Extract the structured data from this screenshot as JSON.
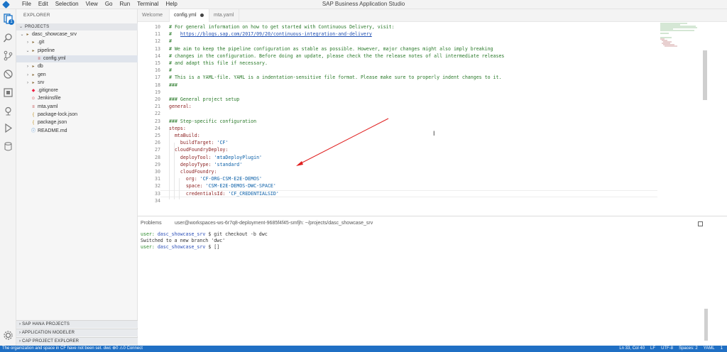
{
  "app": {
    "title": "SAP Business Application Studio",
    "menu": [
      "File",
      "Edit",
      "Selection",
      "View",
      "Go",
      "Run",
      "Terminal",
      "Help"
    ]
  },
  "activity": {
    "badge": "1"
  },
  "sidebar": {
    "title": "EXPLORER",
    "section": "PROJECTS",
    "tree": [
      {
        "label": "dasc_showcase_srv",
        "kind": "folder",
        "twisty": "v",
        "depth": 0
      },
      {
        "label": ".git",
        "kind": "folder",
        "twisty": ">",
        "depth": 1
      },
      {
        "label": "pipeline",
        "kind": "folder",
        "twisty": "v",
        "depth": 1
      },
      {
        "label": "config.yml",
        "kind": "yml",
        "twisty": "",
        "depth": 2,
        "selected": true
      },
      {
        "label": "db",
        "kind": "folder",
        "twisty": ">",
        "depth": 1
      },
      {
        "label": "gen",
        "kind": "folder",
        "twisty": ">",
        "depth": 1
      },
      {
        "label": "srv",
        "kind": "folder",
        "twisty": ">",
        "depth": 1
      },
      {
        "label": ".gitignore",
        "kind": "git",
        "twisty": "",
        "depth": 1
      },
      {
        "label": "Jenkinsfile",
        "kind": "jenkins",
        "twisty": "",
        "depth": 1
      },
      {
        "label": "mta.yaml",
        "kind": "yml",
        "twisty": "",
        "depth": 1
      },
      {
        "label": "package-lock.json",
        "kind": "json",
        "twisty": "",
        "depth": 1
      },
      {
        "label": "package.json",
        "kind": "json",
        "twisty": "",
        "depth": 1
      },
      {
        "label": "README.md",
        "kind": "md",
        "twisty": "",
        "depth": 1
      }
    ],
    "bottom_sections": [
      "SAP HANA PROJECTS",
      "APPLICATION MODELER",
      "CAP PROJECT EXPLORER"
    ]
  },
  "tabs": [
    {
      "label": "Welcome",
      "active": false
    },
    {
      "label": "config.yml",
      "active": true,
      "dirty": true
    },
    {
      "label": "mta.yaml",
      "active": false
    }
  ],
  "editor": {
    "lines": [
      {
        "n": "10",
        "text": "# For general information on how to get started with Continuous Delivery, visit:",
        "cls": "c-comment"
      },
      {
        "n": "11",
        "text": "#   ",
        "cls": "c-comment",
        "url": "https://blogs.sap.com/2017/09/20/continuous-integration-and-delivery"
      },
      {
        "n": "12",
        "text": "#",
        "cls": "c-comment"
      },
      {
        "n": "13",
        "text": "# We aim to keep the pipeline configuration as stable as possible. However, major changes might also imply breaking",
        "cls": "c-comment"
      },
      {
        "n": "14",
        "text": "# changes in the configuration. Before doing an update, please check the the release notes of all intermediate releases",
        "cls": "c-comment"
      },
      {
        "n": "15",
        "text": "# and adapt this file if necessary.",
        "cls": "c-comment"
      },
      {
        "n": "16",
        "text": "#",
        "cls": "c-comment"
      },
      {
        "n": "17",
        "text": "# This is a YAML-file. YAML is a indentation-sensitive file format. Please make sure to properly indent changes to it.",
        "cls": "c-comment"
      },
      {
        "n": "18",
        "text": "###",
        "cls": "c-comment"
      },
      {
        "n": "19",
        "text": "",
        "cls": ""
      },
      {
        "n": "20",
        "text": "### General project setup",
        "cls": "c-comment"
      },
      {
        "n": "21",
        "text": "general:",
        "cls": "c-key"
      },
      {
        "n": "22",
        "text": "",
        "cls": ""
      },
      {
        "n": "23",
        "text": "### Step-specific configuration",
        "cls": "c-comment"
      },
      {
        "n": "24",
        "text": "steps:",
        "cls": "c-key"
      },
      {
        "n": "25",
        "text": "  mtaBuild:",
        "cls": "c-key"
      },
      {
        "n": "26",
        "key": "    buildTarget: ",
        "val": "'CF'"
      },
      {
        "n": "27",
        "text": "  cloudFoundryDeploy:",
        "cls": "c-key"
      },
      {
        "n": "28",
        "key": "    deployTool: ",
        "val": "'mtaDeployPlugin'"
      },
      {
        "n": "29",
        "key": "    deployType: ",
        "val": "'standard'"
      },
      {
        "n": "30",
        "text": "    cloudFoundry:",
        "cls": "c-key"
      },
      {
        "n": "31",
        "key": "      org: ",
        "val": "'CF-ORG-CSM-E2E-DEMOS'"
      },
      {
        "n": "32",
        "key": "      space: ",
        "val": "'CSM-E2E-DEMOS-DWC-SPACE'"
      },
      {
        "n": "33",
        "key": "      credentialsId: ",
        "val": "'CF_CREDENTIALSID'"
      },
      {
        "n": "34",
        "text": "",
        "cls": ""
      }
    ]
  },
  "panel": {
    "tab_problems": "Problems",
    "tab_terminal": "user@workspaces-ws-6r7q8-deployment-9685f4f45-smfjh: ~/projects/dasc_showcase_srv",
    "terminal": [
      {
        "user": "user:",
        "path": " dasc_showcase_srv",
        "rest": " $ git checkout -b dwc"
      },
      {
        "plain": "Switched to a new branch 'dwc'"
      },
      {
        "user": "user:",
        "path": " dasc_showcase_srv",
        "rest": " $ []"
      }
    ]
  },
  "status": {
    "left": "The organization and space in CF have not been set.   dwc   ⊗0 ⚠0   Connect",
    "right": [
      "Ln 33, Col 40",
      "LF",
      "UTF-8",
      "Spaces: 2",
      "YAML",
      "1"
    ]
  },
  "colors": {
    "statusbar": "#1f6fc4",
    "annotation_arrow": "#e02020"
  }
}
